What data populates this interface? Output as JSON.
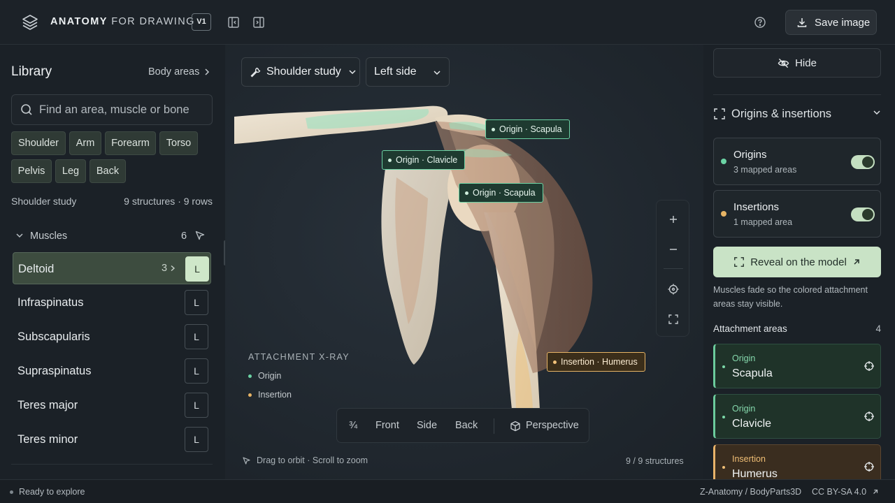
{
  "app": {
    "brand_bold": "ANATOMY",
    "brand_rest": "FOR DRAWING",
    "version": "V1"
  },
  "topbar": {
    "save_label": "Save image",
    "icons": [
      "layers-logo-icon",
      "panel-left-icon",
      "panel-right-icon",
      "help-icon",
      "download-icon"
    ]
  },
  "library": {
    "title": "Library",
    "body_areas_link": "Body areas",
    "search_placeholder": "Find an area, muscle or bone",
    "chips": [
      "Shoulder",
      "Arm",
      "Forearm",
      "Torso",
      "Pelvis",
      "Leg",
      "Back"
    ],
    "study_name": "Shoulder study",
    "study_meta": "9 structures · 9 rows",
    "group_label": "Muscles",
    "group_count": "6",
    "muscles": [
      {
        "name": "Deltoid",
        "count": "3",
        "side": "L",
        "selected": true
      },
      {
        "name": "Infraspinatus",
        "side": "L"
      },
      {
        "name": "Subscapularis",
        "side": "L"
      },
      {
        "name": "Supraspinatus",
        "side": "L"
      },
      {
        "name": "Teres major",
        "side": "L"
      },
      {
        "name": "Teres minor",
        "side": "L"
      }
    ]
  },
  "viewport": {
    "study_dropdown": "Shoulder study",
    "side_dropdown": "Left side",
    "tags": [
      {
        "label": "Origin · Scapula",
        "kind": "origin"
      },
      {
        "label": "Origin · Clavicle",
        "kind": "origin"
      },
      {
        "label": "Origin · Scapula",
        "kind": "origin"
      },
      {
        "label": "Insertion · Humerus",
        "kind": "insertion"
      }
    ],
    "xray": {
      "title": "ATTACHMENT X-RAY",
      "origin": "Origin",
      "insertion": "Insertion"
    },
    "views": {
      "three_quarter": "¾",
      "front": "Front",
      "side": "Side",
      "back": "Back",
      "perspective": "Perspective"
    },
    "hint": "Drag to orbit · Scroll to zoom",
    "structure_count": "9 / 9 structures",
    "colors": {
      "origin": "#6bd3a4",
      "insertion": "#e7b465"
    }
  },
  "panel": {
    "hide_label": "Hide",
    "section_title": "Origins & insertions",
    "origins": {
      "title": "Origins",
      "sub": "3 mapped areas",
      "on": true
    },
    "insertions": {
      "title": "Insertions",
      "sub": "1 mapped area",
      "on": true
    },
    "reveal_label": "Reveal on the model",
    "reveal_note": "Muscles fade so the colored attachment areas stay visible.",
    "attach_title": "Attachment areas",
    "attach_count": "4",
    "areas": [
      {
        "kind": "Origin",
        "bone": "Scapula"
      },
      {
        "kind": "Origin",
        "bone": "Clavicle"
      },
      {
        "kind": "Insertion",
        "bone": "Humerus"
      }
    ]
  },
  "status": {
    "left": "Ready to explore",
    "source": "Z-Anatomy / BodyParts3D",
    "license": "CC BY-SA 4.0"
  }
}
